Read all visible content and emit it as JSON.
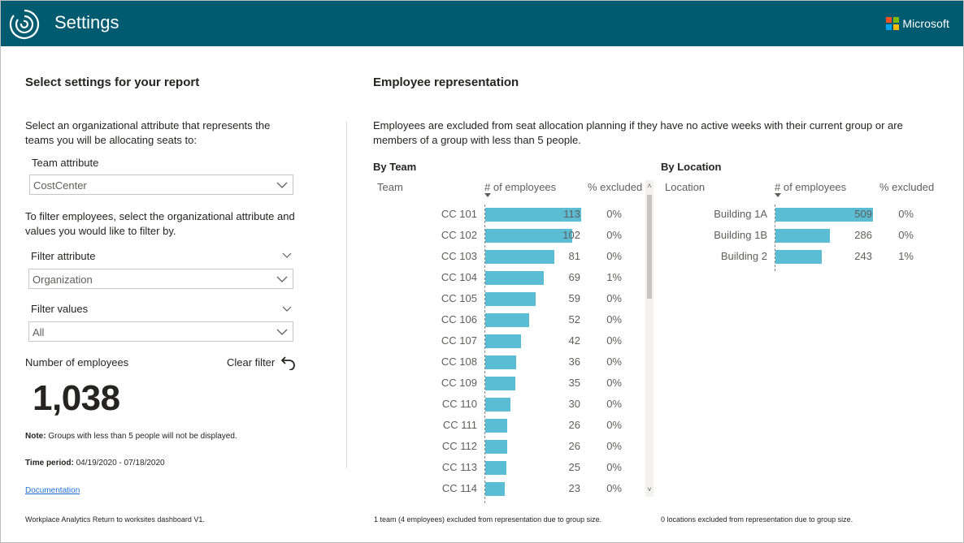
{
  "app": {
    "title": "Settings",
    "brand": "Microsoft"
  },
  "left": {
    "heading": "Select settings for your report",
    "instruction1": "Select an organizational attribute that represents the teams you will be allocating seats to:",
    "team_attribute_label": "Team attribute",
    "team_attribute_value": "CostCenter",
    "instruction2": "To filter employees, select the organizational attribute and values you would like to filter by.",
    "filter_attribute_label": "Filter attribute",
    "filter_attribute_value": "Organization",
    "filter_values_label": "Filter values",
    "filter_values_value": "All",
    "employees_label": "Number of employees",
    "clear_filter": "Clear filter",
    "employee_count": "1,038",
    "note_label": "Note:",
    "note_text": " Groups with less than 5 people will not be displayed.",
    "period_label": "Time period:",
    "period_text": " 04/19/2020 - 07/18/2020",
    "documentation": "Documentation",
    "footer": "Workplace Analytics Return to worksites dashboard V1."
  },
  "right": {
    "heading": "Employee representation",
    "description": "Employees are excluded from seat allocation planning if they have no active weeks with their current group or are members of a group with less than 5 people.",
    "team_footer": "1 team (4 employees) excluded from representation due to group size.",
    "location_footer": "0 locations excluded from representation due to group size."
  },
  "colors": {
    "header": "#005a70",
    "bar": "#5bbdd3"
  },
  "chart_data": [
    {
      "type": "bar",
      "orientation": "horizontal",
      "title": "By Team",
      "columns": [
        "Team",
        "# of employees",
        "% excluded"
      ],
      "categories": [
        "CC 101",
        "CC 102",
        "CC 103",
        "CC 104",
        "CC 105",
        "CC 106",
        "CC 107",
        "CC 108",
        "CC 109",
        "CC 110",
        "CC 111",
        "CC 112",
        "CC 113",
        "CC 114"
      ],
      "values": [
        113,
        102,
        81,
        69,
        59,
        52,
        42,
        36,
        35,
        30,
        26,
        26,
        25,
        23
      ],
      "excluded": [
        "0%",
        "0%",
        "0%",
        "1%",
        "0%",
        "0%",
        "0%",
        "0%",
        "0%",
        "0%",
        "0%",
        "0%",
        "0%",
        "0%"
      ],
      "xlim": [
        0,
        113
      ]
    },
    {
      "type": "bar",
      "orientation": "horizontal",
      "title": "By Location",
      "columns": [
        "Location",
        "# of employees",
        "% excluded"
      ],
      "categories": [
        "Building 1A",
        "Building 1B",
        "Building 2"
      ],
      "values": [
        509,
        286,
        243
      ],
      "excluded": [
        "0%",
        "0%",
        "1%"
      ],
      "xlim": [
        0,
        509
      ]
    }
  ]
}
